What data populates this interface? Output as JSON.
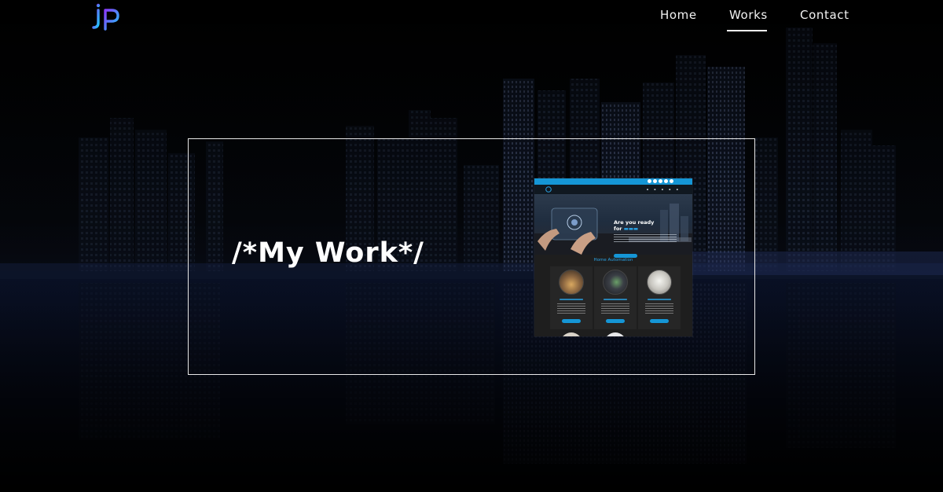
{
  "brand": {
    "logo_alt": "JP",
    "gradient_from": "#8a3cff",
    "gradient_to": "#1fc8ff"
  },
  "nav": {
    "items": [
      {
        "label": "Home",
        "active": false
      },
      {
        "label": "Works",
        "active": true
      },
      {
        "label": "Contact",
        "active": false
      }
    ]
  },
  "hero": {
    "title": "/*My Work*/"
  },
  "project_preview": {
    "hero_heading_line1": "Are you ready",
    "hero_heading_line2": "for",
    "section_title": "Home Automation",
    "accent_color": "#1596d6"
  },
  "colors": {
    "background": "#000000",
    "frame_border": "#e8e8e8",
    "text": "#ffffff"
  }
}
